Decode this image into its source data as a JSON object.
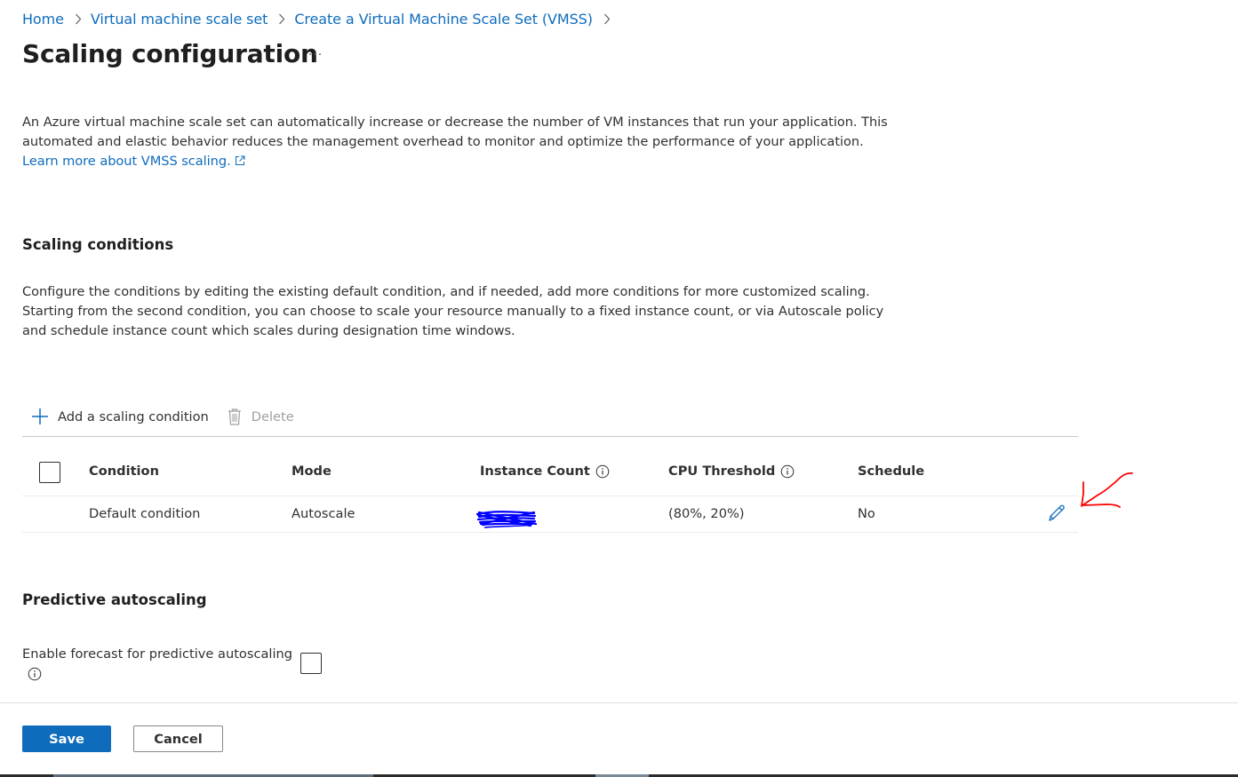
{
  "breadcrumb": {
    "items": [
      "Home",
      "Virtual machine scale set",
      "Create a Virtual Machine Scale Set (VMSS)"
    ],
    "separator_icon": "chevron-right-icon"
  },
  "page": {
    "title": "Scaling configuration",
    "more_label": "···",
    "intro_text": "An Azure virtual machine scale set can automatically increase or decrease the number of VM instances that run your application. This automated and elastic behavior reduces the management overhead to monitor and optimize the performance of your application.",
    "intro_link": "Learn more about VMSS scaling.",
    "external_link_icon": "external-link-icon"
  },
  "scaling_conditions": {
    "title": "Scaling conditions",
    "description": "Configure the conditions by editing the existing default condition, and if needed, add more conditions for more customized scaling. Starting from the second condition, you can choose to scale your resource manually to a fixed instance count, or via Autoscale policy and schedule instance count which scales during designation time windows.",
    "toolbar": {
      "add_label": "Add a scaling condition",
      "delete_label": "Delete"
    },
    "table": {
      "headers": [
        "Condition",
        "Mode",
        "Instance Count",
        "CPU Threshold",
        "Schedule"
      ],
      "rows": [
        {
          "condition": "Default condition",
          "mode": "Autoscale",
          "instance_count": "",
          "instance_count_redacted": true,
          "cpu_threshold": "(80%, 20%)",
          "schedule": "No"
        }
      ]
    }
  },
  "predictive": {
    "title": "Predictive autoscaling",
    "forecast_label": "Enable forecast for predictive autoscaling",
    "forecast_checked": false
  },
  "footer": {
    "save_label": "Save",
    "cancel_label": "Cancel"
  },
  "colors": {
    "accent": "#0f6cbd",
    "text": "#323130",
    "redaction": "#0000ff",
    "annotation": "#ff0000"
  }
}
